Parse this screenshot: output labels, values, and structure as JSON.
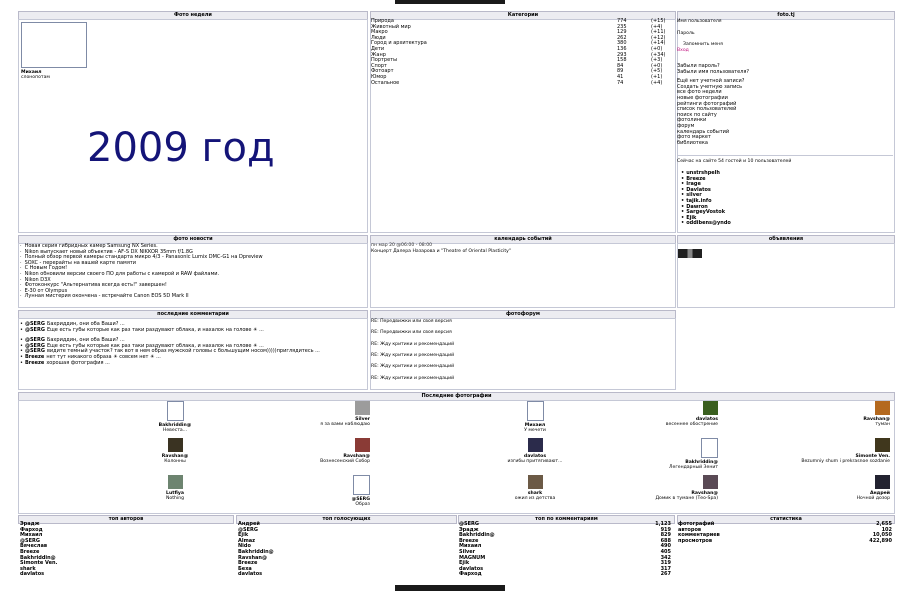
{
  "top_bar": {
    "visible": true
  },
  "photo_week": {
    "header": "Фото недели",
    "author": "Михаил",
    "title": "слонопотам"
  },
  "overlay_year": "2009 год",
  "categories": {
    "header": "Категории",
    "items": [
      {
        "name": "Природа",
        "count": "774",
        "delta": "(+15)"
      },
      {
        "name": "Животный мир",
        "count": "235",
        "delta": "(+4)"
      },
      {
        "name": "Макро",
        "count": "129",
        "delta": "(+11)"
      },
      {
        "name": "Люди",
        "count": "262",
        "delta": "(+12)"
      },
      {
        "name": "Город и архитектура",
        "count": "380",
        "delta": "(+14)"
      },
      {
        "name": "Дети",
        "count": "136",
        "delta": "(+0)"
      },
      {
        "name": "Жанр",
        "count": "293",
        "delta": "(+34)"
      },
      {
        "name": "Портреты",
        "count": "158",
        "delta": "(+3)"
      },
      {
        "name": "Спорт",
        "count": "84",
        "delta": "(+0)"
      },
      {
        "name": "Фотоарт",
        "count": "89",
        "delta": "(+5)"
      },
      {
        "name": "Юмор",
        "count": "41",
        "delta": "(+1)"
      },
      {
        "name": "Остальное",
        "count": "74",
        "delta": "(+4)"
      }
    ]
  },
  "login": {
    "header": "foto.tj",
    "username_label": "Имя пользователя",
    "password_label": "Пароль",
    "remember_label": "Запомнить меня",
    "login_button": "Вход",
    "links": [
      "Забыли пароль?",
      "Забыли имя пользователя?",
      "Ещё нет учетной записи?",
      "Создать учетную запись",
      "все фото недели",
      "новые фотографии",
      "рейтинги фотографий",
      "список пользователей",
      "поиск по сайту",
      "фотолинки",
      "форум",
      "календарь событий",
      "фото маркет",
      "библиотека"
    ],
    "online_text": "Сейчас на сайте 54 гостей и 10 пользователей",
    "online_users": [
      "unstrshpelh",
      "Breeze",
      "Irage",
      "Davlatos",
      "silver",
      "tajik.info",
      "Dawron",
      "SargeyVostok",
      "Ejik",
      "oddibens@yndo"
    ]
  },
  "news": {
    "header": "фото новости",
    "items": [
      "Новая серия гибридных камер Samsung NX Series.",
      "Nikon выпускает новый объектив - AF-S DX NIKKOR 35mm f/1.8G",
      "Полный обзор первой камеры стандарта микро 4/3 - Panasonic Lumix DMC-G1 на Dpreview",
      "SOXC - перерайты на вашей карте памяти",
      "С Новым Годом!",
      "Nikon обновили версии своего ПО для работы с камерой и RAW файлами.",
      "Nikon D3X",
      "Фотоконкурс \"Альтернатива всегда есть!\" завершен!",
      "E-30 от Olympus",
      "Лунная мистерия окончена - встречайте Canon EOS 5D Mark II"
    ]
  },
  "calendar": {
    "header": "календарь событий",
    "date": "пн мар 20 @06:00 - 08:00",
    "event": "Концерт Далера Назарова и \"Theatre of Oriental Plasticity\""
  },
  "ads": {
    "header": "объявления"
  },
  "comments": {
    "header": "последние комментарии",
    "items": [
      {
        "author": "@SERG",
        "text": "Бахриддин, они оба Ваши? ..."
      },
      {
        "author": "@SERG",
        "text": "Еще есть губы которые как раз таки раздувают облака, и нахалок на голове ☀ ..."
      },
      {
        "author": "@SERG",
        "text": "Бахриддин, они оба Ваши? ..."
      },
      {
        "author": "@SERG",
        "text": "Еще есть губы которые как раз таки раздувают облака, и нахалок на голове ☀ ..."
      },
      {
        "author": "@SERG",
        "text": "видите темный участок? так вот в нем образ мужской головы с большущим носом)))))приглядитесь ..."
      },
      {
        "author": "Breeze",
        "text": "нет тут никакого образа ☀ совсем нет ☀ ..."
      },
      {
        "author": "Breeze",
        "text": "хорошая фотография ..."
      }
    ]
  },
  "forum": {
    "header": "фотофорум",
    "items": [
      "RE: Передвижки или своя версия",
      "RE: Передвижки или своя версия",
      "RE: Жду критики и рекомендаций",
      "RE: Жду критики и рекомендаций",
      "RE: Жду критики и рекомендаций",
      "RE: Жду критики и рекомендаций"
    ]
  },
  "last_photos": {
    "header": "Последние фотографии",
    "items": [
      {
        "author": "Bakhriddin@",
        "title": "Невеста..."
      },
      {
        "author": "Silver",
        "title": "я за вами наблюдаю"
      },
      {
        "author": "Михаил",
        "title": "У мечети"
      },
      {
        "author": "davlatos",
        "title": "весеннее обострение"
      },
      {
        "author": "Ravshan@",
        "title": "туман"
      },
      {
        "author": "Ravshan@",
        "title": "Колонны"
      },
      {
        "author": "Ravshan@",
        "title": "Вознесенский Собор"
      },
      {
        "author": "davlatos",
        "title": "изгибы притягивают..."
      },
      {
        "author": "Bakhriddin@",
        "title": "Легендарный Зенит"
      },
      {
        "author": "Simonte Ven.",
        "title": "Bezumniy shum i prekrasnoe sozdanie"
      },
      {
        "author": "Lutfiya",
        "title": "Nothing"
      },
      {
        "author": "@SERG",
        "title": "Образ"
      },
      {
        "author": "shark",
        "title": "ожил из детства"
      },
      {
        "author": "Ravshan@",
        "title": "Домик в тумане (Тео-Spa)"
      },
      {
        "author": "Андрей",
        "title": "Ночной дозор"
      }
    ]
  },
  "top_authors": {
    "header": "топ авторов",
    "names": [
      "Эрадж",
      "Фарход",
      "Михаил",
      "@SERG",
      "Вячеслав",
      "Breeze",
      "Bakhriddin@",
      "Simonte Ven.",
      "shark",
      "davlatos"
    ],
    "counts": [
      "Андрей",
      "@SERG",
      "Ejik",
      "Almaz",
      "Nido",
      "Bakhriddin@",
      "Ravshan@",
      "Breeze",
      "Беха",
      "davlatos"
    ]
  },
  "top_voters": {
    "header": "топ голосующих"
  },
  "top_comments": {
    "header": "топ по комментариям",
    "rows": [
      {
        "name": "@SERG",
        "value": "1,123"
      },
      {
        "name": "Эрадж",
        "value": "919"
      },
      {
        "name": "Bakhriddin@",
        "value": "829"
      },
      {
        "name": "Breeze",
        "value": "688"
      },
      {
        "name": "Михаил",
        "value": "490"
      },
      {
        "name": "Silver",
        "value": "405"
      },
      {
        "name": "MAGNUM",
        "value": "342"
      },
      {
        "name": "Ejik",
        "value": "319"
      },
      {
        "name": "davlatos",
        "value": "317"
      },
      {
        "name": "Фарход",
        "value": "267"
      }
    ]
  },
  "stats": {
    "header": "статистика",
    "rows": [
      {
        "name": "фотографий",
        "value": "2,655"
      },
      {
        "name": "авторов",
        "value": "102"
      },
      {
        "name": "комментариев",
        "value": "10,050"
      },
      {
        "name": "просмотров",
        "value": "422,890"
      }
    ]
  }
}
